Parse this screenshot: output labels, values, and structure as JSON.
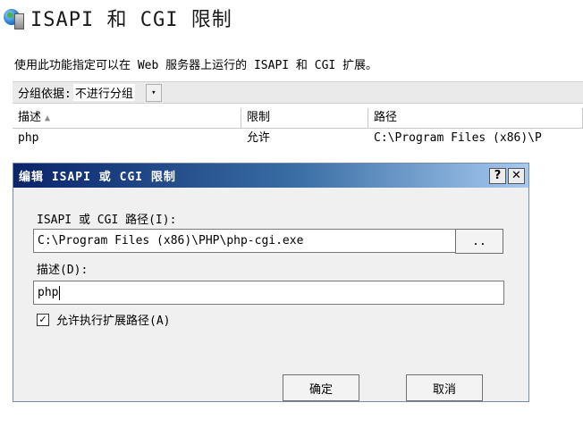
{
  "header": {
    "title": "ISAPI 和 CGI 限制",
    "icon": "globe-server-icon"
  },
  "description": "使用此功能指定可以在 Web 服务器上运行的 ISAPI 和 CGI 扩展。",
  "group_bar": {
    "label": "分组依据:",
    "value": "不进行分组",
    "arrow": "▾"
  },
  "grid": {
    "columns": [
      "描述",
      "限制",
      "路径"
    ],
    "sort_indicator": "▲",
    "rows": [
      {
        "description": "php",
        "restriction": "允许",
        "path": "C:\\Program Files (x86)\\P"
      }
    ]
  },
  "dialog": {
    "title": "编辑 ISAPI 或 CGI 限制",
    "help_label": "?",
    "close_label": "✕",
    "path_label": "ISAPI 或 CGI 路径(I):",
    "path_value": "C:\\Program Files (x86)\\PHP\\php-cgi.exe",
    "browse_label": "..",
    "desc_label": "描述(D):",
    "desc_value": "php",
    "checkbox_label": "允许执行扩展路径(A)",
    "checkbox_mark": "✓",
    "checkbox_checked": true,
    "ok_label": "确定",
    "cancel_label": "取消",
    "colors": {
      "title_start": "#0a246a",
      "title_end": "#a6caf0",
      "face": "#f0f0f0"
    }
  }
}
